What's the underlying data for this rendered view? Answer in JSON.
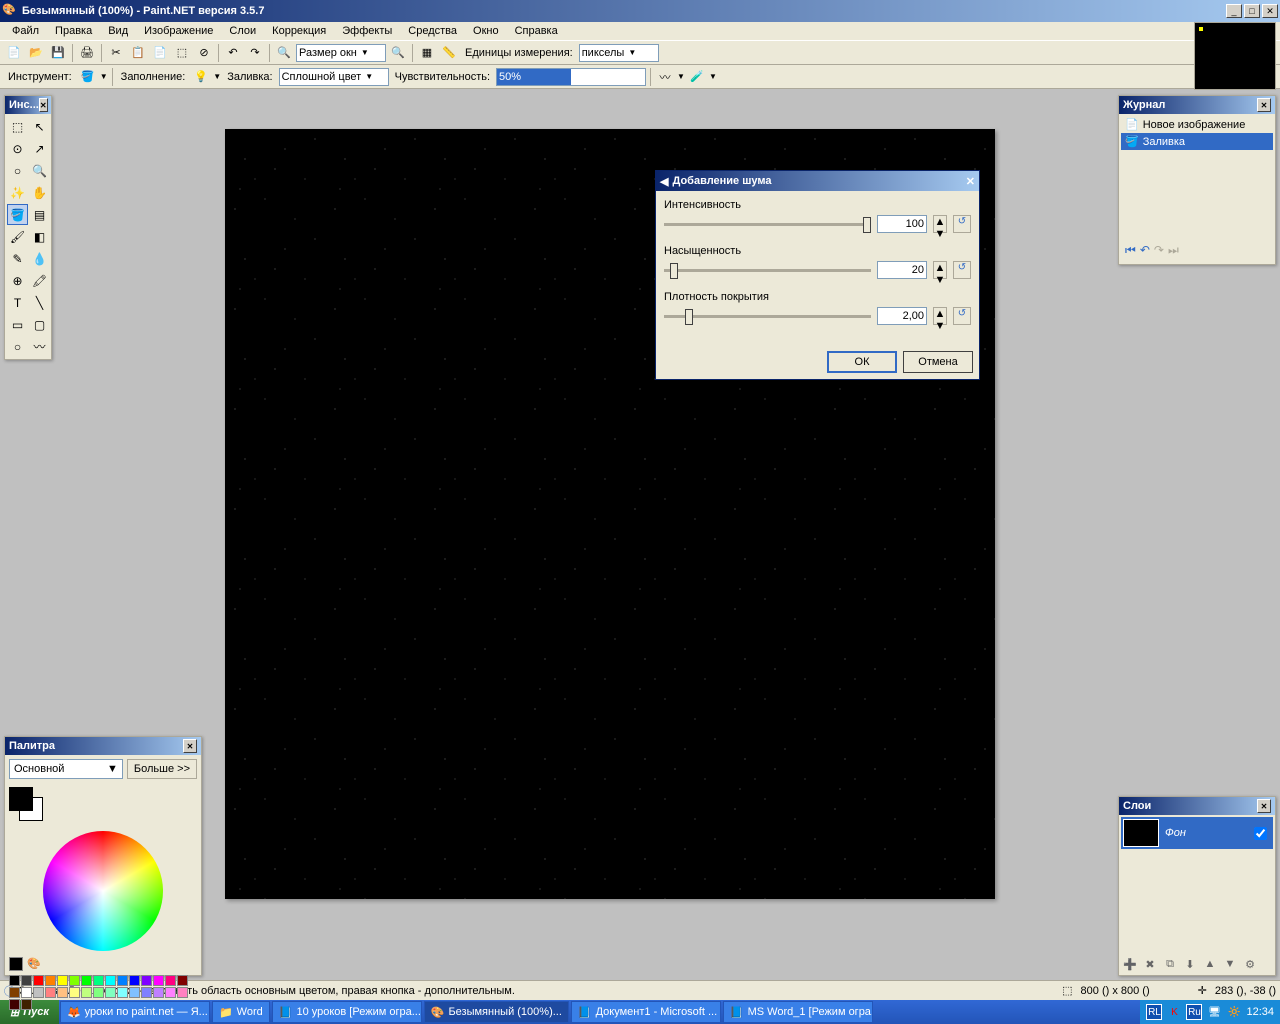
{
  "window": {
    "title": "Безымянный (100%) - Paint.NET версия 3.5.7"
  },
  "menu": [
    "Файл",
    "Правка",
    "Вид",
    "Изображение",
    "Слои",
    "Коррекция",
    "Эффекты",
    "Средства",
    "Окно",
    "Справка"
  ],
  "toolbar1": {
    "size_label": "Размер окн",
    "units_label": "Единицы измерения:",
    "units_value": "пикселы"
  },
  "toolbar2": {
    "instrument_label": "Инструмент:",
    "fill_label": "Заполнение:",
    "flood_label": "Заливка:",
    "flood_value": "Сплошной цвет",
    "sensitivity_label": "Чувствительность:",
    "sensitivity_value": "50%"
  },
  "tools_panel": {
    "title": "Инс..."
  },
  "history_panel": {
    "title": "Журнал",
    "items": [
      "Новое изображение",
      "Заливка"
    ]
  },
  "layers_panel": {
    "title": "Слои",
    "layer": "Фон"
  },
  "palette_panel": {
    "title": "Палитра",
    "primary": "Основной",
    "more": "Больше >>"
  },
  "dialog": {
    "title": "Добавление шума",
    "intensity_label": "Интенсивность",
    "intensity_value": "100",
    "saturation_label": "Насыщенность",
    "saturation_value": "20",
    "coverage_label": "Плотность покрытия",
    "coverage_value": "2,00",
    "ok": "ОК",
    "cancel": "Отмена"
  },
  "statusbar": {
    "hint": "Заливка. Левая кнопка - заполнить область основным цветом, правая кнопка - дополнительным.",
    "size": "800 () x 800 ()",
    "pos": "283 (), -38 ()"
  },
  "taskbar": {
    "start": "Пуск",
    "tasks": [
      "уроки по paint.net — Я...",
      "Word",
      "10 уроков [Режим огра...",
      "Безымянный (100%)...",
      "Документ1 - Microsoft ...",
      "MS Word_1 [Режим огра..."
    ],
    "time": "12:34"
  },
  "palette_colors": [
    "#000",
    "#404040",
    "#ff0000",
    "#ff8000",
    "#ffff00",
    "#80ff00",
    "#00ff00",
    "#00ff80",
    "#00ffff",
    "#0080ff",
    "#0000ff",
    "#8000ff",
    "#ff00ff",
    "#ff0080",
    "#800000",
    "#804000",
    "#fff",
    "#c0c0c0",
    "#ff8080",
    "#ffc080",
    "#ffff80",
    "#c0ff80",
    "#80ff80",
    "#80ffc0",
    "#80ffff",
    "#80c0ff",
    "#8080ff",
    "#c080ff",
    "#ff80ff",
    "#ff80c0",
    "#400000",
    "#402000"
  ]
}
